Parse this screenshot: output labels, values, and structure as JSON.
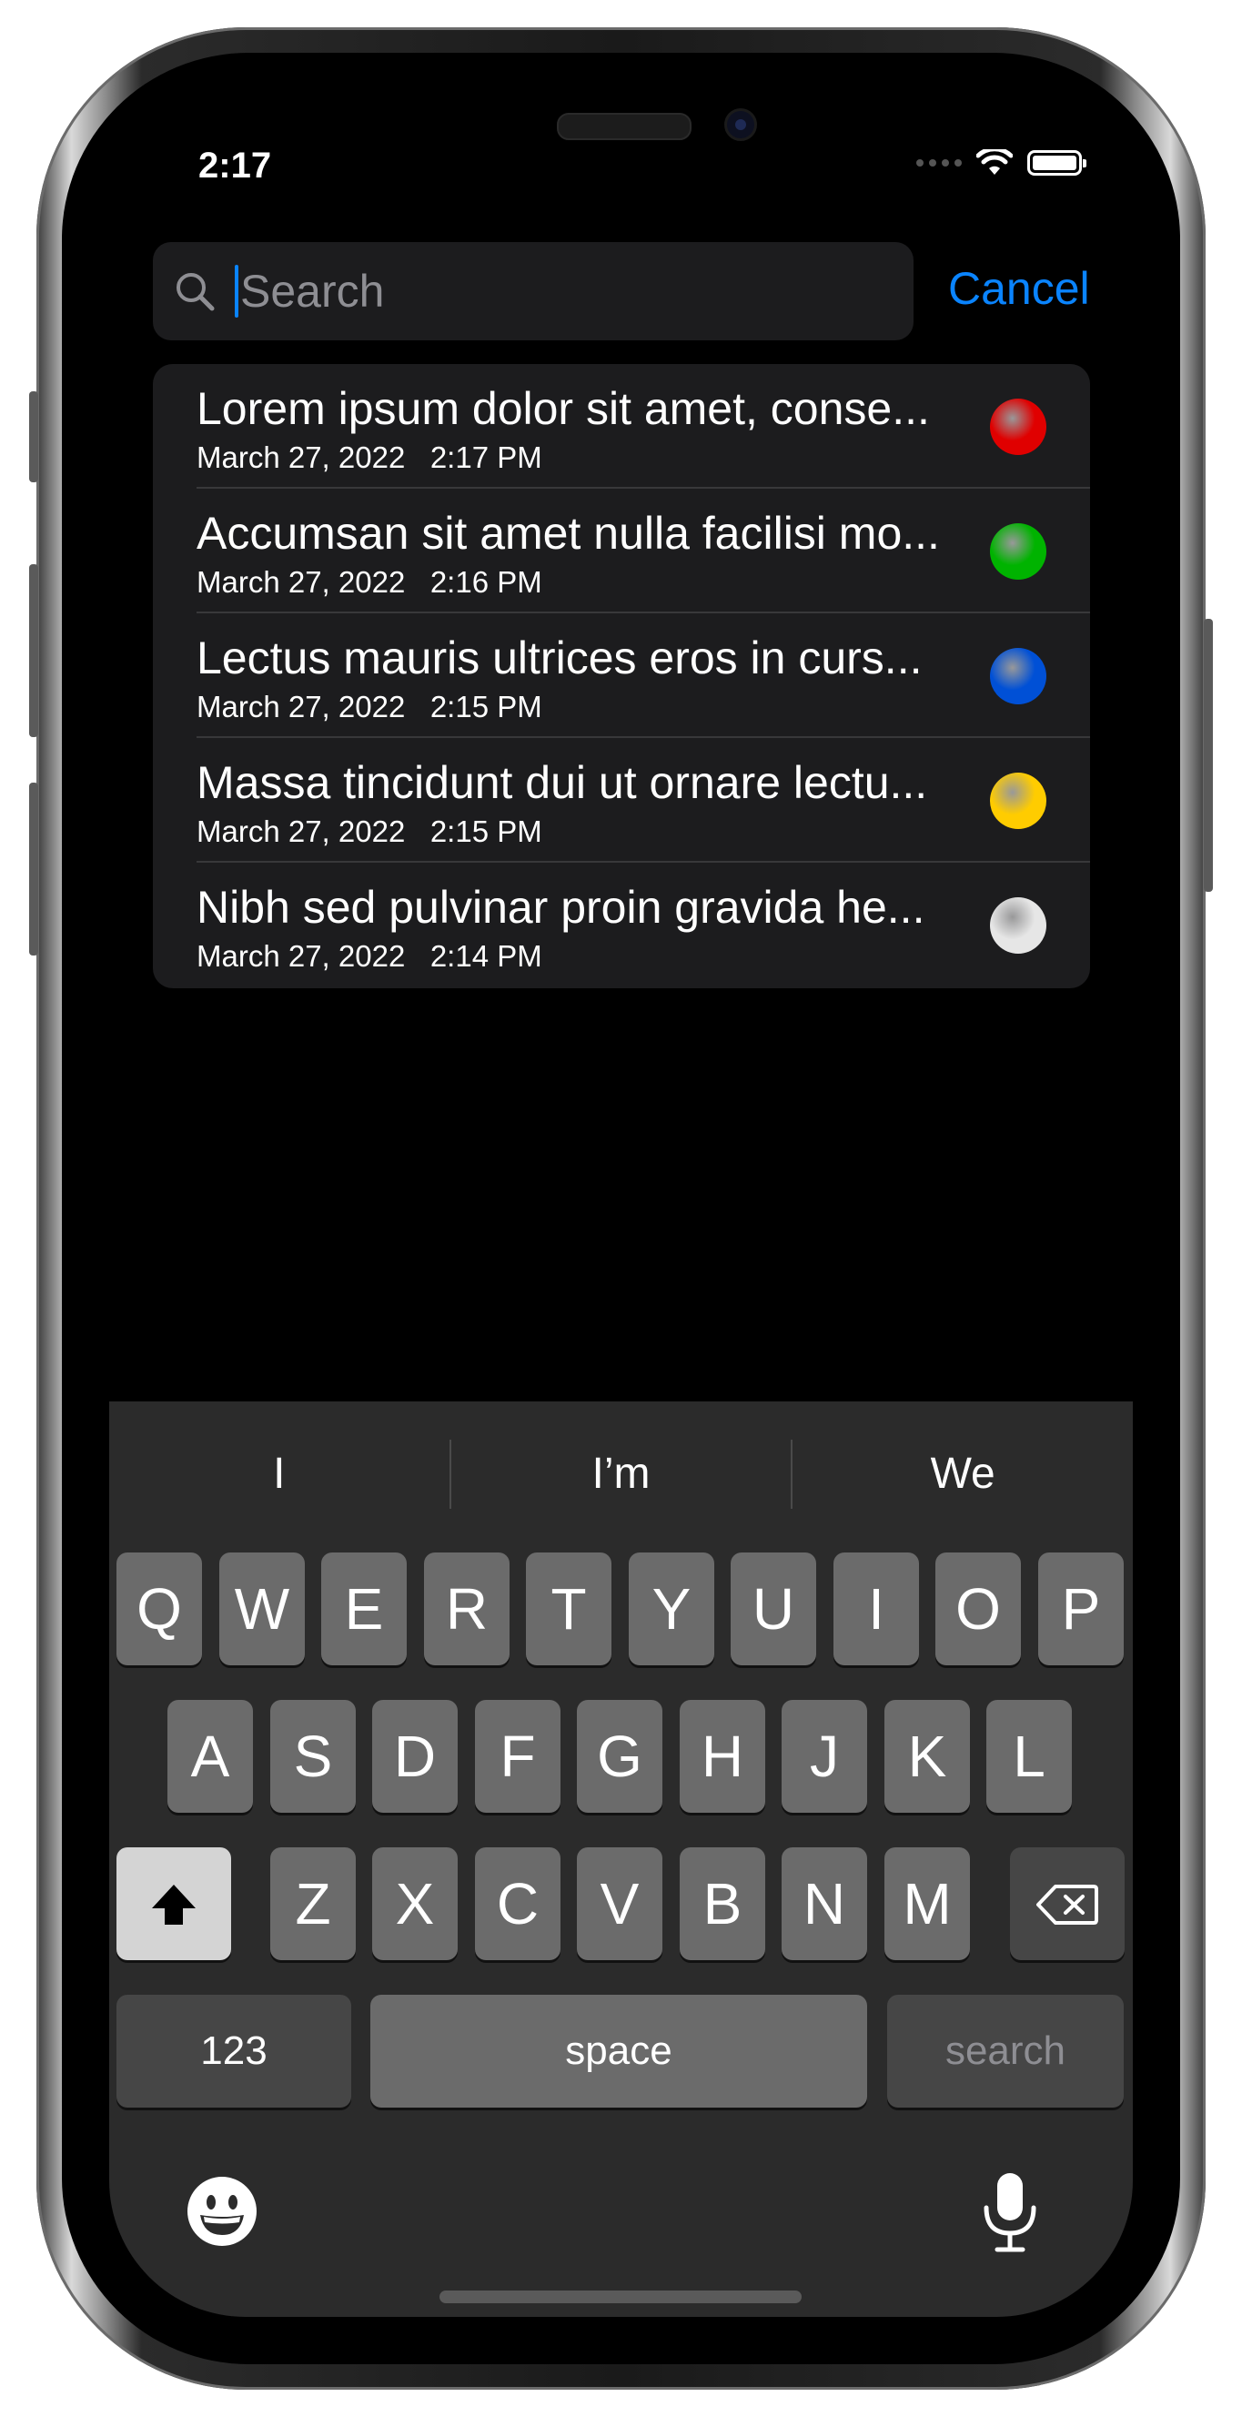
{
  "status": {
    "time": "2:17"
  },
  "search": {
    "placeholder": "Search",
    "value": "",
    "cancel_label": "Cancel"
  },
  "notes": [
    {
      "title": "Lorem ipsum dolor sit amet, conse...",
      "date": "March 27, 2022",
      "time": "2:17 PM",
      "color": "#e00000"
    },
    {
      "title": "Accumsan sit amet nulla facilisi mo...",
      "date": "March 27, 2022",
      "time": "2:16 PM",
      "color": "#00b300"
    },
    {
      "title": "Lectus mauris ultrices eros in curs...",
      "date": "March 27, 2022",
      "time": "2:15 PM",
      "color": "#0050d6"
    },
    {
      "title": "Massa tincidunt dui ut ornare lectu...",
      "date": "March 27, 2022",
      "time": "2:15 PM",
      "color": "#ffcc00"
    },
    {
      "title": "Nibh sed pulvinar proin gravida he...",
      "date": "March 27, 2022",
      "time": "2:14 PM",
      "color": "#e6e6e6"
    }
  ],
  "keyboard": {
    "predictions": [
      "I",
      "I’m",
      "We"
    ],
    "row1": [
      "Q",
      "W",
      "E",
      "R",
      "T",
      "Y",
      "U",
      "I",
      "O",
      "P"
    ],
    "row2": [
      "A",
      "S",
      "D",
      "F",
      "G",
      "H",
      "J",
      "K",
      "L"
    ],
    "row3": [
      "Z",
      "X",
      "C",
      "V",
      "B",
      "N",
      "M"
    ],
    "numbers_label": "123",
    "space_label": "space",
    "return_label": "search"
  }
}
